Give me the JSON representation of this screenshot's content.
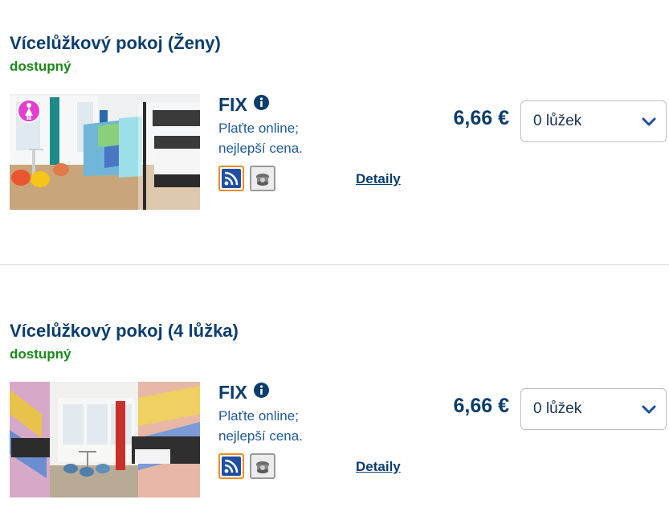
{
  "rooms": [
    {
      "title": "Vícelůžkový pokoj (Ženy)",
      "status": "dostupný",
      "photo_badge_icon": "female-icon",
      "rate": {
        "name": "FIX",
        "info_icon": "info-icon",
        "description_line1": "Plaťte online;",
        "description_line2": "nejlepší cena.",
        "amenities": [
          "wifi-icon",
          "bed-linen-icon"
        ],
        "details_label": "Detaily",
        "price": "6,66 €",
        "beds_selected": "0 lůžek"
      }
    },
    {
      "title": "Vícelůžkový pokoj (4 lůžka)",
      "status": "dostupný",
      "rate": {
        "name": "FIX",
        "info_icon": "info-icon",
        "description_line1": "Plaťte online;",
        "description_line2": "nejlepší cena.",
        "amenities": [
          "wifi-icon",
          "bed-linen-icon"
        ],
        "details_label": "Detaily",
        "price": "6,66 €",
        "beds_selected": "0 lůžek"
      }
    }
  ],
  "colors": {
    "heading": "#0b3d6e",
    "available": "#1a8a1a",
    "link": "#1f5a96",
    "wifi_border": "#f08c1e",
    "divider": "#d6d6d6"
  }
}
